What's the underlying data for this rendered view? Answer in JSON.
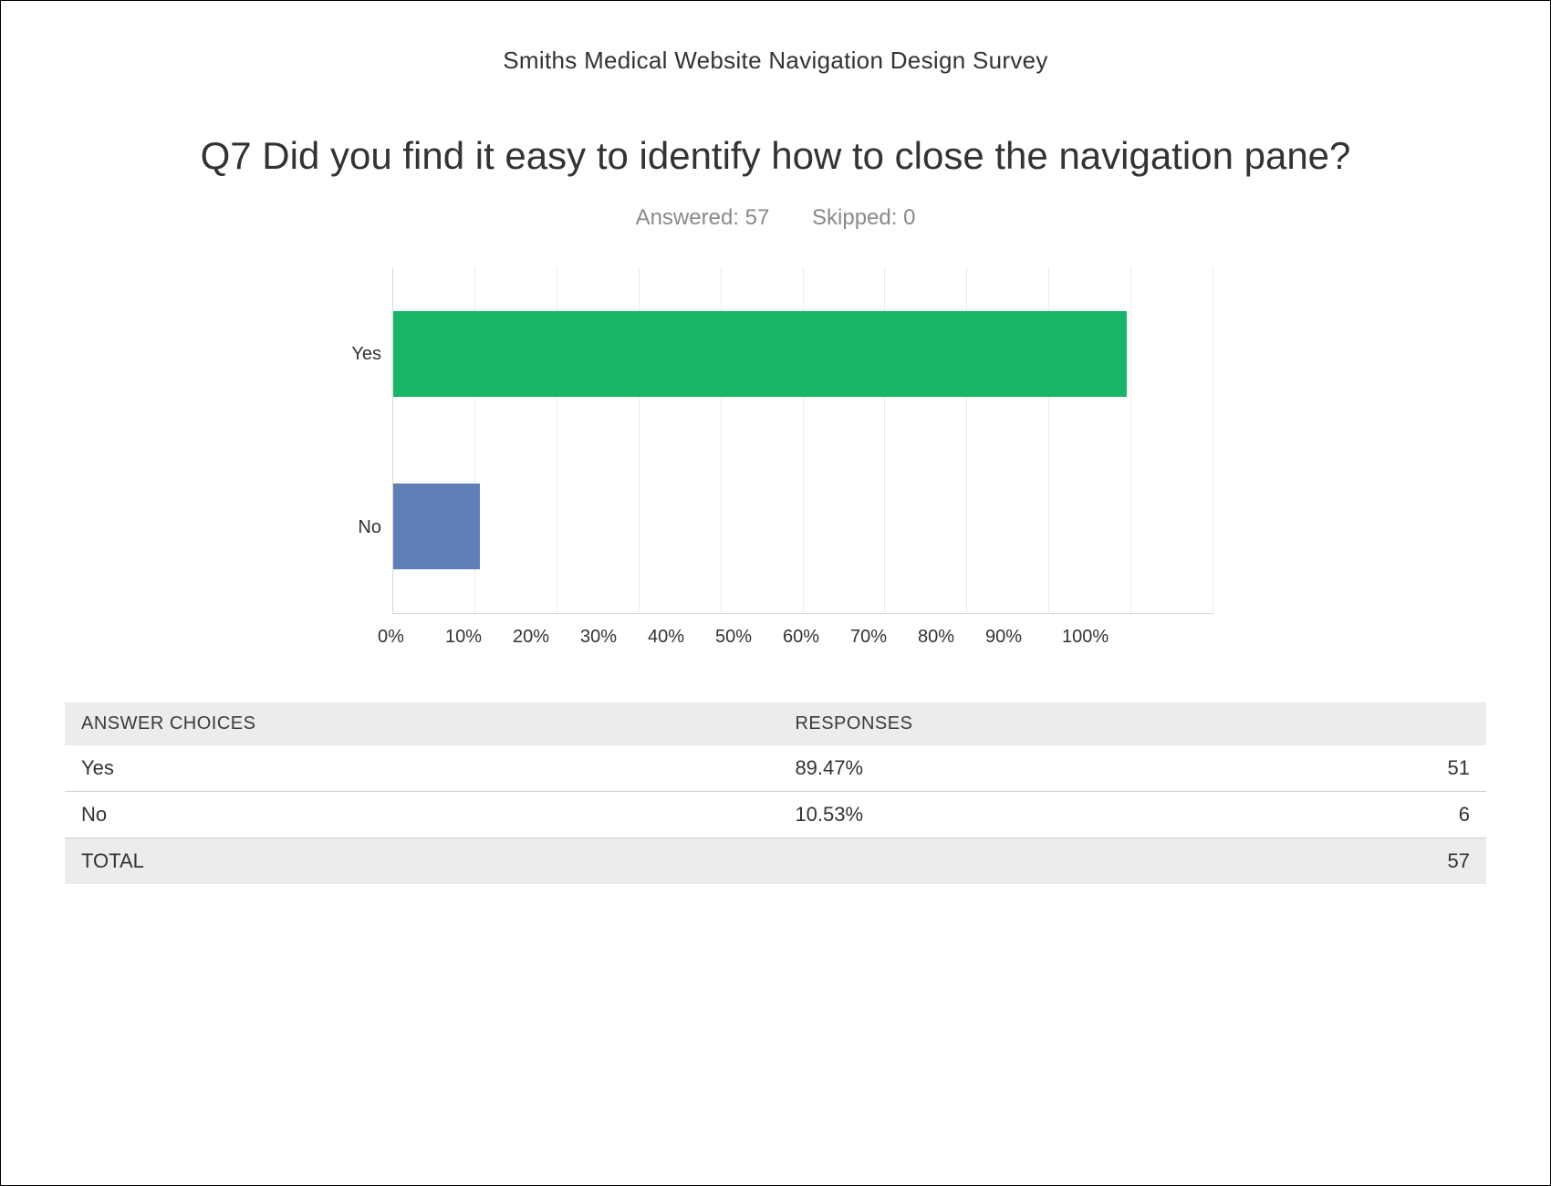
{
  "survey_title": "Smiths Medical Website Navigation Design Survey",
  "question_title": "Q7 Did you find it easy to identify how to close the navigation pane?",
  "stats": {
    "answered_label": "Answered: 57",
    "skipped_label": "Skipped: 0"
  },
  "headers": {
    "answer_choices": "ANSWER CHOICES",
    "responses": "RESPONSES"
  },
  "rows": [
    {
      "label": "Yes",
      "pct": "89.47%",
      "count": "51"
    },
    {
      "label": "No",
      "pct": "10.53%",
      "count": "6"
    }
  ],
  "total": {
    "label": "TOTAL",
    "count": "57"
  },
  "xticks": [
    "0%",
    "10%",
    "20%",
    "30%",
    "40%",
    "50%",
    "60%",
    "70%",
    "80%",
    "90%",
    "100%"
  ],
  "chart_data": {
    "type": "bar",
    "orientation": "horizontal",
    "categories": [
      "Yes",
      "No"
    ],
    "values": [
      89.47,
      10.53
    ],
    "series_colors": [
      "#18b666",
      "#5e80b6"
    ],
    "xlabel": "",
    "ylabel": "",
    "xlim": [
      0,
      100
    ],
    "title": "Q7 Did you find it easy to identify how to close the navigation pane?",
    "answered": 57,
    "skipped": 0,
    "counts": [
      51,
      6
    ],
    "total": 57
  }
}
